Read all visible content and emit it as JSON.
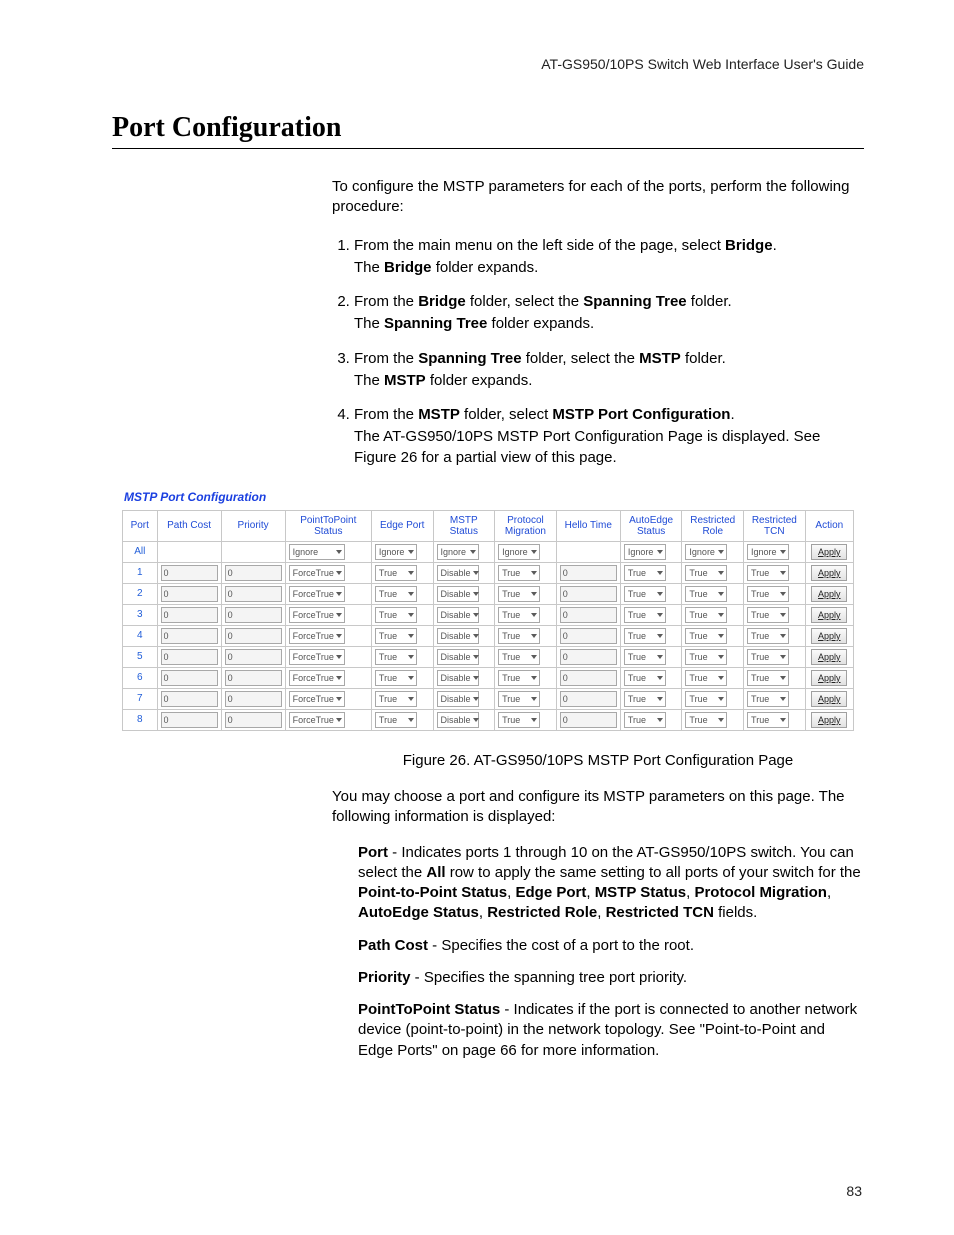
{
  "document_header": "AT-GS950/10PS Switch Web Interface User's Guide",
  "page_number": "83",
  "section_title": "Port Configuration",
  "intro": "To configure the MSTP parameters for each of the ports, perform the following procedure:",
  "steps": [
    {
      "lead": "From the main menu on the left side of the page, select ",
      "bold1": "Bridge",
      "after_bold1": ".",
      "sub_pre": "The ",
      "sub_bold": "Bridge",
      "sub_post": " folder expands."
    },
    {
      "lead": "From the ",
      "bold1": "Bridge",
      "after_bold1": " folder, select the ",
      "bold2": "Spanning Tree",
      "after_bold2": " folder.",
      "sub_pre": "The ",
      "sub_bold": "Spanning Tree",
      "sub_post": " folder expands."
    },
    {
      "lead": "From the ",
      "bold1": "Spanning Tree",
      "after_bold1": " folder, select the ",
      "bold2": "MSTP",
      "after_bold2": " folder.",
      "sub_pre": "The ",
      "sub_bold": "MSTP",
      "sub_post": " folder expands."
    },
    {
      "lead": "From the ",
      "bold1": "MSTP",
      "after_bold1": " folder, select ",
      "bold2": "MSTP Port Configuration",
      "after_bold2": ".",
      "sub_full": "The AT-GS950/10PS MSTP Port Configuration Page is displayed. See Figure 26 for a partial view of this page."
    }
  ],
  "webfig": {
    "title": "MSTP Port Configuration",
    "headers": {
      "port": "Port",
      "path_cost": "Path Cost",
      "priority": "Priority",
      "p2p": "PointToPoint Status",
      "edge": "Edge Port",
      "mstp": "MSTP Status",
      "proto": "Protocol Migration",
      "hello": "Hello Time",
      "autoedge": "AutoEdge Status",
      "r_role": "Restricted Role",
      "r_tcn": "Restricted TCN",
      "action": "Action"
    },
    "all_row": {
      "port": "All",
      "p2p": "Ignore",
      "edge": "Ignore",
      "mstp": "Ignore",
      "proto": "Ignore",
      "autoedge": "Ignore",
      "r_role": "Ignore",
      "r_tcn": "Ignore",
      "apply": "Apply"
    },
    "rows": [
      {
        "port": "1",
        "path_cost": "0",
        "priority": "0",
        "p2p": "ForceTrue",
        "edge": "True",
        "mstp": "Disable",
        "proto": "True",
        "hello": "0",
        "autoedge": "True",
        "r_role": "True",
        "r_tcn": "True",
        "apply": "Apply"
      },
      {
        "port": "2",
        "path_cost": "0",
        "priority": "0",
        "p2p": "ForceTrue",
        "edge": "True",
        "mstp": "Disable",
        "proto": "True",
        "hello": "0",
        "autoedge": "True",
        "r_role": "True",
        "r_tcn": "True",
        "apply": "Apply"
      },
      {
        "port": "3",
        "path_cost": "0",
        "priority": "0",
        "p2p": "ForceTrue",
        "edge": "True",
        "mstp": "Disable",
        "proto": "True",
        "hello": "0",
        "autoedge": "True",
        "r_role": "True",
        "r_tcn": "True",
        "apply": "Apply"
      },
      {
        "port": "4",
        "path_cost": "0",
        "priority": "0",
        "p2p": "ForceTrue",
        "edge": "True",
        "mstp": "Disable",
        "proto": "True",
        "hello": "0",
        "autoedge": "True",
        "r_role": "True",
        "r_tcn": "True",
        "apply": "Apply"
      },
      {
        "port": "5",
        "path_cost": "0",
        "priority": "0",
        "p2p": "ForceTrue",
        "edge": "True",
        "mstp": "Disable",
        "proto": "True",
        "hello": "0",
        "autoedge": "True",
        "r_role": "True",
        "r_tcn": "True",
        "apply": "Apply"
      },
      {
        "port": "6",
        "path_cost": "0",
        "priority": "0",
        "p2p": "ForceTrue",
        "edge": "True",
        "mstp": "Disable",
        "proto": "True",
        "hello": "0",
        "autoedge": "True",
        "r_role": "True",
        "r_tcn": "True",
        "apply": "Apply"
      },
      {
        "port": "7",
        "path_cost": "0",
        "priority": "0",
        "p2p": "ForceTrue",
        "edge": "True",
        "mstp": "Disable",
        "proto": "True",
        "hello": "0",
        "autoedge": "True",
        "r_role": "True",
        "r_tcn": "True",
        "apply": "Apply"
      },
      {
        "port": "8",
        "path_cost": "0",
        "priority": "0",
        "p2p": "ForceTrue",
        "edge": "True",
        "mstp": "Disable",
        "proto": "True",
        "hello": "0",
        "autoedge": "True",
        "r_role": "True",
        "r_tcn": "True",
        "apply": "Apply"
      }
    ]
  },
  "figure_caption": "Figure 26. AT-GS950/10PS MSTP Port Configuration Page",
  "after_fig_p": "You may choose a port and configure its MSTP parameters on this page. The following information is displayed:",
  "defs": {
    "port_label": "Port",
    "port_text_a": " - Indicates ports 1 through 10 on the AT-GS950/10PS switch. You can select the ",
    "port_bold_all": "All",
    "port_text_b": " row to apply the same setting to all ports of your switch for the ",
    "b_p2p": "Point-to-Point Status",
    "c1": ", ",
    "b_edge": "Edge Port",
    "c2": ", ",
    "b_mstp": "MSTP Status",
    "c3": ", ",
    "b_proto": "Protocol Migration",
    "c4": ", ",
    "b_auto": "AutoEdge Status",
    "c5": ", ",
    "b_rrole": "Restricted Role",
    "c6": ", ",
    "b_rtcn": "Restricted TCN",
    "port_text_c": " fields.",
    "pathcost_label": "Path Cost",
    "pathcost_text": " - Specifies the cost of a port to the root.",
    "priority_label": "Priority",
    "priority_text": " - Specifies the spanning tree port priority.",
    "p2p2_label": "PointToPoint Status",
    "p2p2_text": " - Indicates if the port is connected to another network device (point-to-point) in the network topology. See \"Point-to-Point and Edge Ports\" on page 66 for more information."
  }
}
